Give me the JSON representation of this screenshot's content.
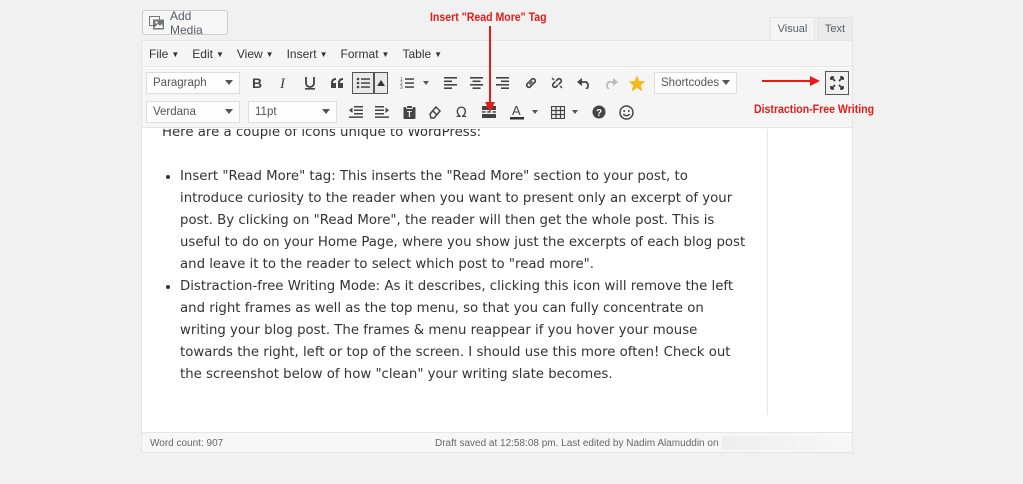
{
  "add_media": {
    "label": "Add Media",
    "icon": "add-media-icon"
  },
  "tabs": [
    {
      "label": "Visual",
      "active": true
    },
    {
      "label": "Text",
      "active": false
    }
  ],
  "menubar": {
    "items": [
      {
        "label": "File"
      },
      {
        "label": "Edit"
      },
      {
        "label": "View"
      },
      {
        "label": "Insert"
      },
      {
        "label": "Format"
      },
      {
        "label": "Table"
      }
    ]
  },
  "toolbar": {
    "paragraph_select": "Paragraph",
    "font_select": "Verdana",
    "size_select": "11pt",
    "shortcodes_select": "Shortcodes"
  },
  "content": {
    "intro": "Here are a couple of icons unique to WordPress:",
    "items": [
      "Insert \"Read More\" tag: This inserts the \"Read More\" section to your post, to introduce curiosity to the reader when you want to present only an excerpt of your post. By clicking on \"Read More\", the reader will then get the whole post. This is useful to do on your Home Page, where you show just the excerpts of each blog post and leave it to the reader to select which post to \"read more\".",
      "Distraction-free Writing Mode: As it describes, clicking this icon will remove the left and right frames as well as the top menu, so that you can fully concentrate on writing your blog post. The frames & menu reappear if you hover your mouse towards the right, left or top of the screen.  I should use this more often! Check out the screenshot below of how \"clean\" your writing slate becomes."
    ]
  },
  "status": {
    "word_count": "Word count: 907",
    "saved": "Draft saved at 12:58:08 pm. Last edited by Nadim Alamuddin on"
  },
  "annotations": {
    "read_more": "Insert \"Read More\" Tag",
    "distraction_free": "Distraction-Free Writing"
  },
  "colors": {
    "annotation_red": "#e41b17",
    "star_gold": "#f5b91f",
    "editor_bg": "#ffffff",
    "page_bg": "#f1f1f1"
  }
}
